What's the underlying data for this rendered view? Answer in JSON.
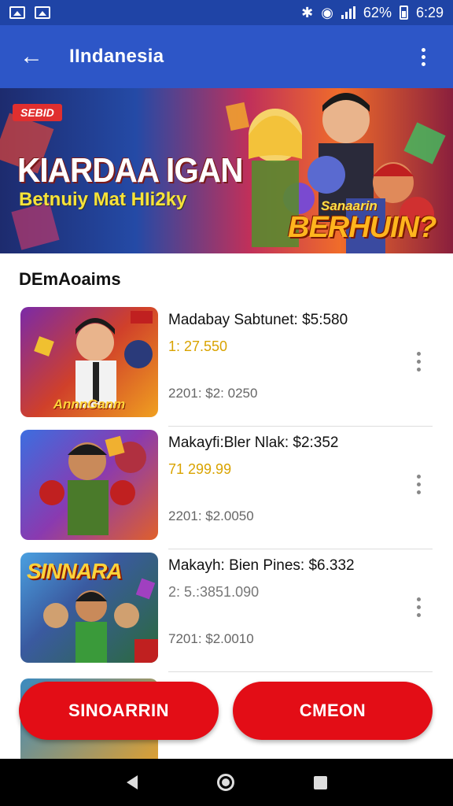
{
  "status_bar": {
    "battery_text": "62%",
    "time": "6:29",
    "icons": [
      "gallery-icon",
      "photo-icon",
      "bluetooth-icon",
      "wifi-icon",
      "signal-icon",
      "battery-icon"
    ]
  },
  "app_bar": {
    "title": "IIndanesia",
    "back_icon": "arrow-left-icon",
    "more_icon": "more-vertical-icon"
  },
  "banner": {
    "tag": "SEBID",
    "title": "KIARDAA IGAN",
    "subtitle": "Betnuiy Mat HIi2ky",
    "badge_small": "Sanaarin",
    "badge_big": "BERHUIN?"
  },
  "section": {
    "title": "DEmAoaims"
  },
  "items": [
    {
      "name": "Madabay Sabtunet: $5:580",
      "price": "1: 27.550",
      "meta": "2201: $2: 0250",
      "thumb_label": "AnnnGanm",
      "thumb_color_a": "#7a2aa8",
      "thumb_color_b": "#f0a020"
    },
    {
      "name": "Makayfi:Bler Nlak: $2:352",
      "price": "71 299.99",
      "meta": "2201: $2.0050",
      "thumb_label": "",
      "thumb_color_a": "#3c6ee0",
      "thumb_color_b": "#e0602a"
    },
    {
      "name": "Makayh: Bien Pines: $6.332",
      "price": "2: 5.:3851.090",
      "meta": "7201: $2.0010",
      "thumb_label": "SINNARA",
      "thumb_color_a": "#2a6a3a",
      "thumb_color_b": "#4aa0e0"
    }
  ],
  "buttons": {
    "left": "SINOARRIN",
    "right": "CMEON"
  },
  "colors": {
    "status_bar": "#1f44a6",
    "app_bar": "#2d56c7",
    "cta": "#e30d16",
    "price": "#d9a300"
  }
}
